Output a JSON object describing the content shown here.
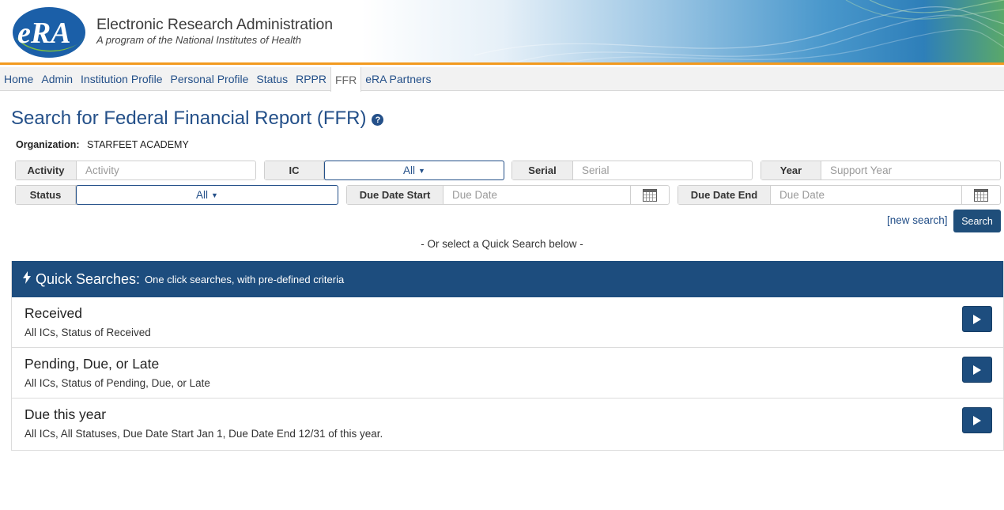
{
  "header": {
    "title": "Electronic Research Administration",
    "subtitle": "A program of the National Institutes of Health",
    "logo_text": "eRA",
    "accent_orange": "#f29a1f",
    "brand_blue": "#245089"
  },
  "nav": {
    "items": [
      {
        "label": "Home"
      },
      {
        "label": "Admin"
      },
      {
        "label": "Institution Profile"
      },
      {
        "label": "Personal Profile"
      },
      {
        "label": "Status"
      },
      {
        "label": "RPPR"
      },
      {
        "label": "FFR",
        "active": true
      },
      {
        "label": "eRA Partners"
      }
    ]
  },
  "page": {
    "title": "Search for Federal Financial Report (FFR)",
    "help_icon": "question-circle-icon",
    "organization_label": "Organization:",
    "organization_value": "STARFEET ACADEMY"
  },
  "filters": {
    "activity": {
      "label": "Activity",
      "placeholder": "Activity",
      "value": ""
    },
    "ic": {
      "label": "IC",
      "value": "All"
    },
    "serial": {
      "label": "Serial",
      "placeholder": "Serial",
      "value": ""
    },
    "year": {
      "label": "Year",
      "placeholder": "Support Year",
      "value": ""
    },
    "status": {
      "label": "Status",
      "value": "All"
    },
    "due_date_start": {
      "label": "Due Date Start",
      "placeholder": "Due Date",
      "value": ""
    },
    "due_date_end": {
      "label": "Due Date End",
      "placeholder": "Due Date",
      "value": ""
    },
    "calendar_icon": "calendar-icon"
  },
  "actions": {
    "new_search": "[new search]",
    "search": "Search",
    "or_select": "- Or select a Quick Search below -"
  },
  "quick_searches": {
    "title": "Quick Searches:",
    "subtitle": "One click searches, with pre-defined criteria",
    "icon": "bolt-icon",
    "header_color": "#1d4d7e",
    "items": [
      {
        "name": "Received",
        "description": "All ICs, Status of Received"
      },
      {
        "name": "Pending, Due, or Late",
        "description": "All ICs, Status of Pending, Due, or Late"
      },
      {
        "name": "Due this year",
        "description": "All ICs, All Statuses, Due Date Start Jan 1, Due Date End 12/31 of this year."
      }
    ]
  }
}
